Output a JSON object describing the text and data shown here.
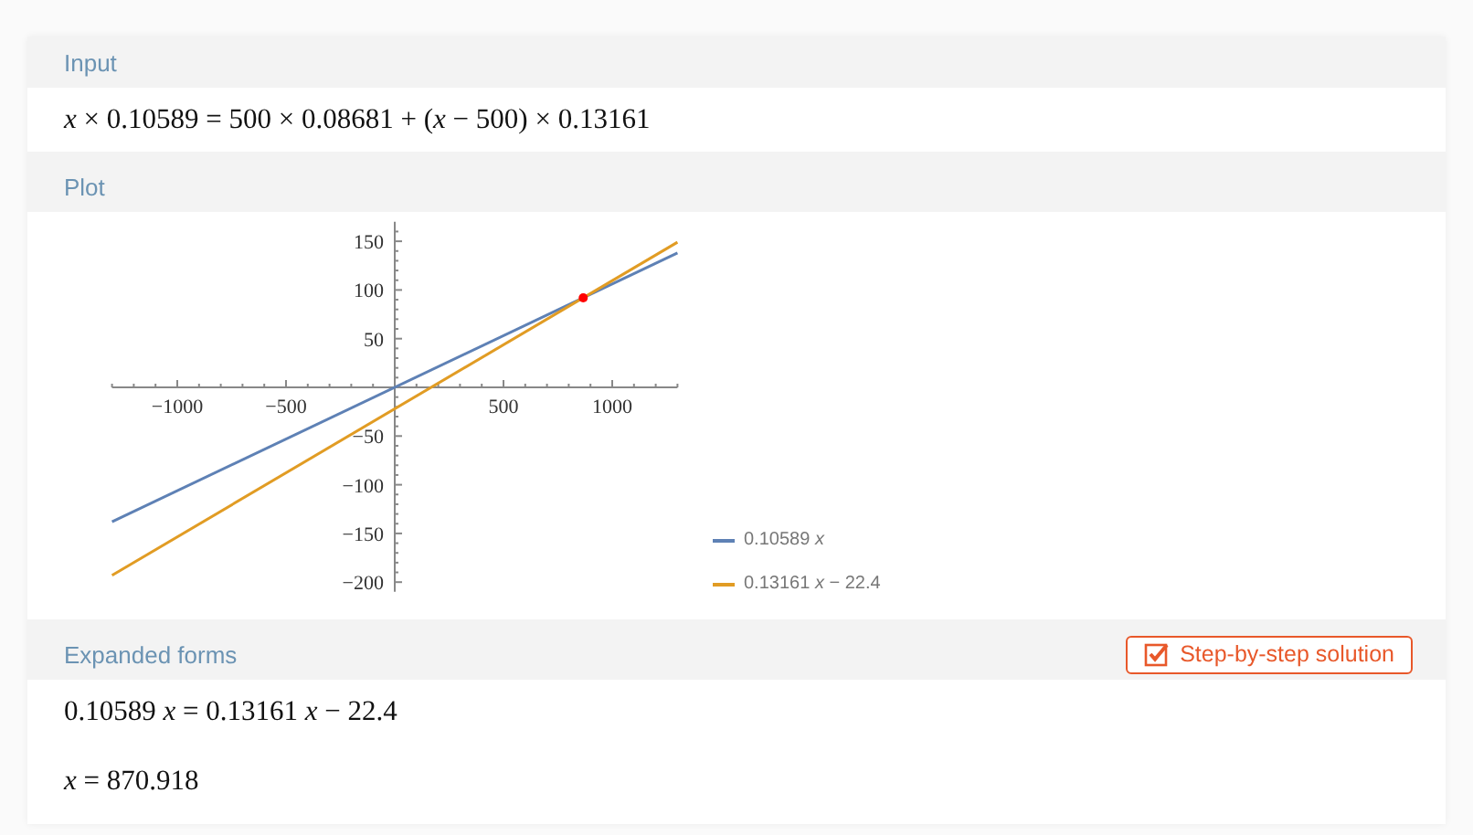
{
  "pods": [
    {
      "kind": "math",
      "title": "Input",
      "lines": [
        "*x* × 0.10589 = 500 × 0.08681 + (*x* − 500) × 0.13161"
      ]
    },
    {
      "kind": "plot",
      "title": "Plot",
      "chart_data": {
        "type": "line",
        "x": [
          -1300,
          1300
        ],
        "series": [
          {
            "name": "0.10589 *x*",
            "color": "#5e81b5",
            "values": [
              -138,
              138
            ]
          },
          {
            "name": "0.13161 *x* − 22.4",
            "color": "#e19c24",
            "values": [
              -193,
              149
            ]
          }
        ],
        "legend": "right",
        "xlim": [
          -1300,
          1300
        ],
        "ylim": [
          -210,
          170
        ],
        "xticks": [
          {
            "value": -1000,
            "label": "−1000"
          },
          {
            "value": -500,
            "label": "−500"
          },
          500,
          1000
        ],
        "yticks": [
          150,
          100,
          50,
          {
            "value": -50,
            "label": "−50"
          },
          {
            "value": -100,
            "label": "−100"
          },
          {
            "value": -150,
            "label": "−150"
          },
          {
            "value": -200,
            "label": "−200"
          }
        ]
      }
    },
    {
      "kind": "math",
      "title": "Expanded forms",
      "button": "Step-by-step solution",
      "lines": [
        "0.10589 *x* = 0.13161 *x* − 22.4",
        "*x* = 870.918"
      ]
    }
  ]
}
